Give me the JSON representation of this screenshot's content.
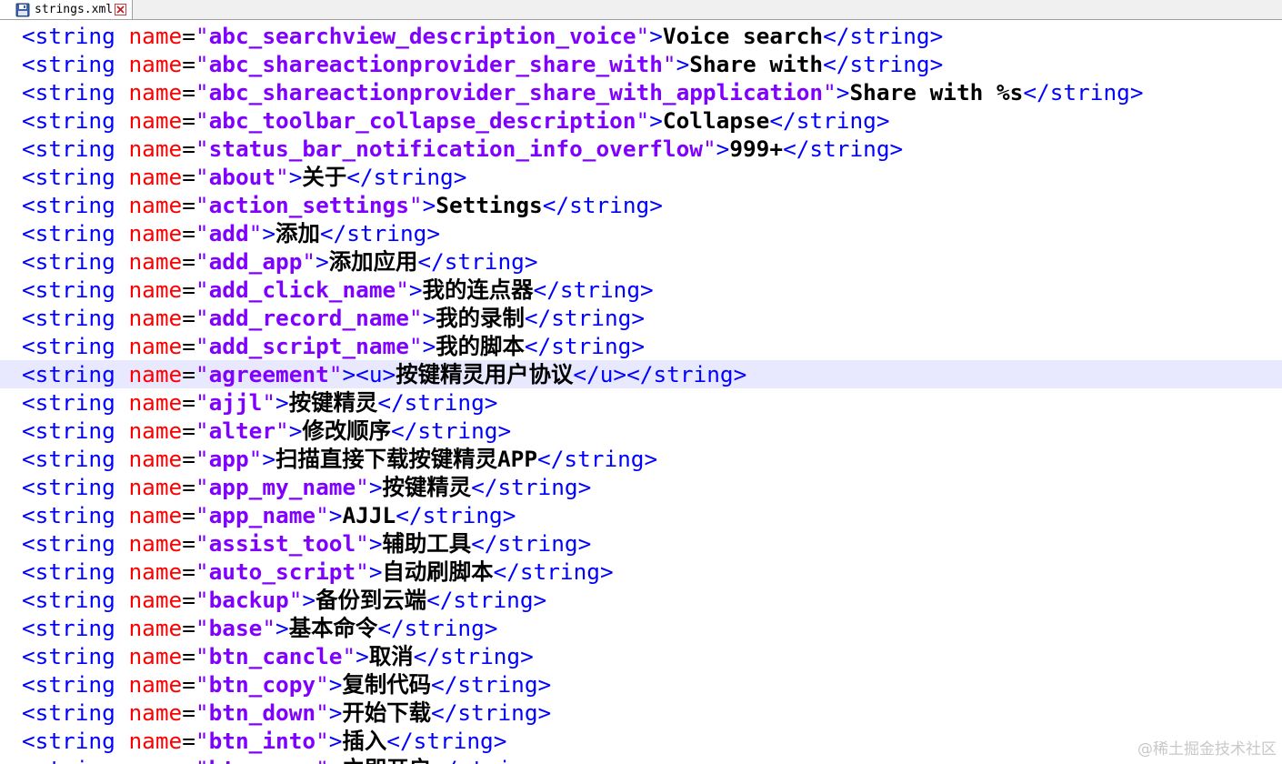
{
  "tab": {
    "title": "strings.xml",
    "icons": {
      "file": "save-icon",
      "close": "close-icon"
    }
  },
  "editor": {
    "colors": {
      "tag": "#0000ff",
      "attribute": "#ff0000",
      "value": "#8000ff",
      "text": "#000000",
      "highlight": "#e8e8ff"
    },
    "highlighted_line": 12,
    "lines": [
      {
        "name": "abc_searchview_description_voice",
        "value": "Voice search"
      },
      {
        "name": "abc_shareactionprovider_share_with",
        "value": "Share with"
      },
      {
        "name": "abc_shareactionprovider_share_with_application",
        "value": "Share with %s"
      },
      {
        "name": "abc_toolbar_collapse_description",
        "value": "Collapse"
      },
      {
        "name": "status_bar_notification_info_overflow",
        "value": "999+"
      },
      {
        "name": "about",
        "value": "关于"
      },
      {
        "name": "action_settings",
        "value": "Settings"
      },
      {
        "name": "add",
        "value": "添加"
      },
      {
        "name": "add_app",
        "value": "添加应用"
      },
      {
        "name": "add_click_name",
        "value": "我的连点器"
      },
      {
        "name": "add_record_name",
        "value": "我的录制"
      },
      {
        "name": "add_script_name",
        "value": "我的脚本"
      },
      {
        "name": "agreement",
        "value": "按键精灵用户协议",
        "wrap": "u"
      },
      {
        "name": "ajjl",
        "value": "按键精灵"
      },
      {
        "name": "alter",
        "value": "修改顺序"
      },
      {
        "name": "app",
        "value": "扫描直接下载按键精灵APP"
      },
      {
        "name": "app_my_name",
        "value": "按键精灵"
      },
      {
        "name": "app_name",
        "value": "AJJL"
      },
      {
        "name": "assist_tool",
        "value": "辅助工具"
      },
      {
        "name": "auto_script",
        "value": "自动刷脚本"
      },
      {
        "name": "backup",
        "value": "备份到云端"
      },
      {
        "name": "base",
        "value": "基本命令"
      },
      {
        "name": "btn_cancle",
        "value": "取消"
      },
      {
        "name": "btn_copy",
        "value": "复制代码"
      },
      {
        "name": "btn_down",
        "value": "开始下载"
      },
      {
        "name": "btn_into",
        "value": "插入"
      },
      {
        "name": "btn_open",
        "value": "立即开启"
      }
    ]
  },
  "watermark": "@稀土掘金技术社区"
}
